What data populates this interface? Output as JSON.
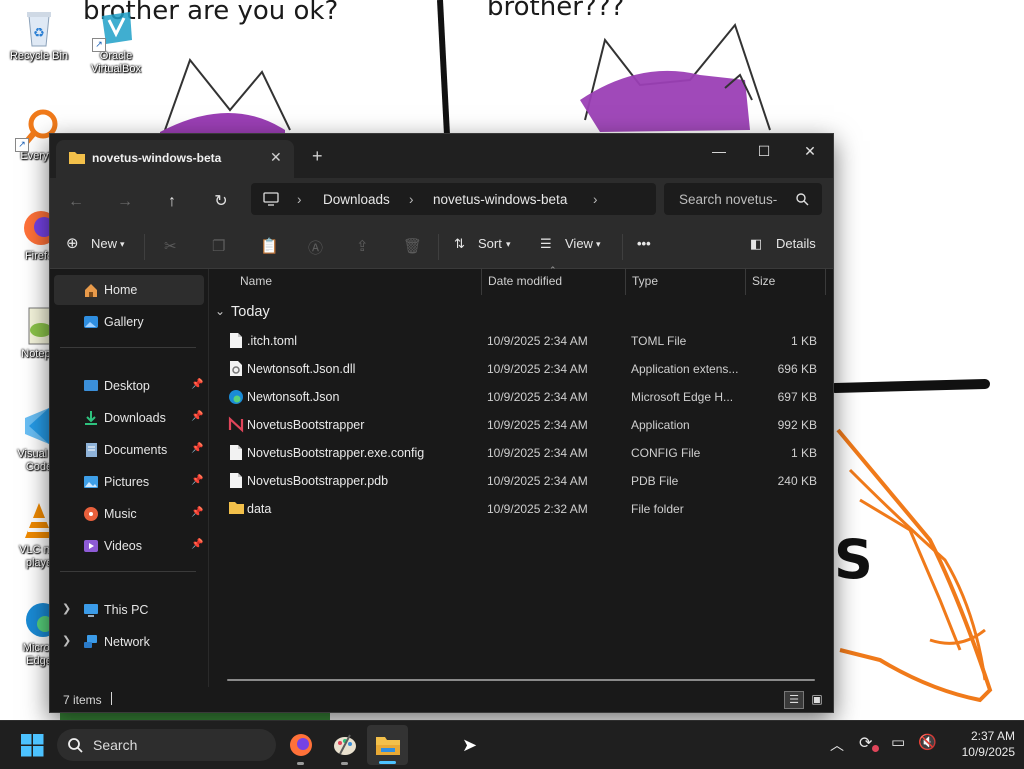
{
  "wallpaper": {
    "caption_left": "brother are you ok?",
    "caption_right": "brother???",
    "drawn_letter": "S"
  },
  "desktop_icons": [
    {
      "label": "Recycle Bin",
      "icon": "recycle-bin-icon"
    },
    {
      "label": "Oracle\nVirtualBox",
      "icon": "virtualbox-icon"
    },
    {
      "label": "Everyth",
      "icon": "everything-search-icon"
    },
    {
      "label": "Firefo",
      "icon": "firefox-icon"
    },
    {
      "label": "Notepa",
      "icon": "notepad-plus-plus-icon"
    },
    {
      "label": "Visual St\nCode",
      "icon": "vscode-icon"
    },
    {
      "label": "VLC me\nplaye",
      "icon": "vlc-icon"
    },
    {
      "label": "Micros\nEdge",
      "icon": "edge-icon"
    }
  ],
  "window": {
    "tab_title": "novetus-windows-beta",
    "new_tab": "+",
    "controls": {
      "minimize": "—",
      "maximize": "☐",
      "close": "✕"
    }
  },
  "address": {
    "breadcrumbs": [
      "Downloads",
      "novetus-windows-beta"
    ],
    "search_placeholder": "Search novetus-"
  },
  "toolbar": {
    "new_label": "New",
    "sort_label": "Sort",
    "view_label": "View",
    "more_label": "•••",
    "details_label": "Details"
  },
  "sidebar": {
    "top": [
      {
        "label": "Home",
        "icon": "home-icon",
        "selected": true
      },
      {
        "label": "Gallery",
        "icon": "gallery-icon"
      }
    ],
    "pinned": [
      {
        "label": "Desktop",
        "icon": "desktop-icon"
      },
      {
        "label": "Downloads",
        "icon": "downloads-icon"
      },
      {
        "label": "Documents",
        "icon": "documents-icon"
      },
      {
        "label": "Pictures",
        "icon": "pictures-icon"
      },
      {
        "label": "Music",
        "icon": "music-icon"
      },
      {
        "label": "Videos",
        "icon": "videos-icon"
      }
    ],
    "bottom": [
      {
        "label": "This PC",
        "icon": "this-pc-icon"
      },
      {
        "label": "Network",
        "icon": "network-icon"
      }
    ]
  },
  "columns": {
    "name": "Name",
    "date": "Date modified",
    "type": "Type",
    "size": "Size"
  },
  "group_label": "Today",
  "files": [
    {
      "name": ".itch.toml",
      "date": "10/9/2025 2:34 AM",
      "type": "TOML File",
      "size": "1 KB",
      "icon": "file-icon"
    },
    {
      "name": "Newtonsoft.Json.dll",
      "date": "10/9/2025 2:34 AM",
      "type": "Application extens...",
      "size": "696 KB",
      "icon": "dll-file-icon"
    },
    {
      "name": "Newtonsoft.Json",
      "date": "10/9/2025 2:34 AM",
      "type": "Microsoft Edge H...",
      "size": "697 KB",
      "icon": "edge-file-icon"
    },
    {
      "name": "NovetusBootstrapper",
      "date": "10/9/2025 2:34 AM",
      "type": "Application",
      "size": "992 KB",
      "icon": "novetus-app-icon"
    },
    {
      "name": "NovetusBootstrapper.exe.config",
      "date": "10/9/2025 2:34 AM",
      "type": "CONFIG File",
      "size": "1 KB",
      "icon": "file-icon"
    },
    {
      "name": "NovetusBootstrapper.pdb",
      "date": "10/9/2025 2:34 AM",
      "type": "PDB File",
      "size": "240 KB",
      "icon": "file-icon"
    },
    {
      "name": "data",
      "date": "10/9/2025 2:32 AM",
      "type": "File folder",
      "size": "",
      "icon": "folder-icon"
    }
  ],
  "status": {
    "item_count": "7 items"
  },
  "taskbar": {
    "search_label": "Search",
    "pinned_apps": [
      "firefox-icon",
      "paint-icon",
      "file-explorer-icon"
    ],
    "clock_time": "2:37 AM",
    "clock_date": "10/9/2025"
  },
  "colors": {
    "window_bg": "#191919",
    "bar_bg": "#2c2c2c",
    "accent": "#4cc2ff",
    "folder": "#f3c04a",
    "wallpaper_purple": "#9b3fb5",
    "wallpaper_orange": "#f07a1a"
  }
}
